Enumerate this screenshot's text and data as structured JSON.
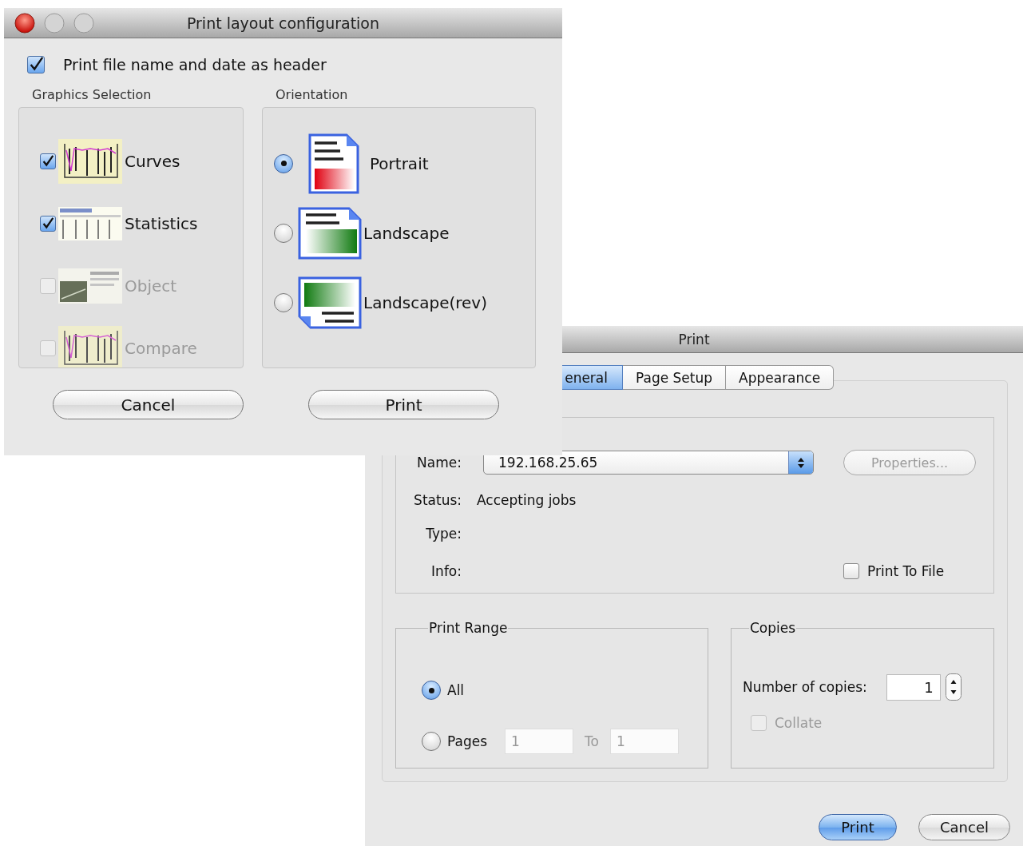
{
  "layout_dialog": {
    "title": "Print layout configuration",
    "header_option": {
      "label": "Print file name and date as header",
      "checked": true
    },
    "graphics_selection": {
      "label": "Graphics Selection",
      "items": [
        {
          "label": "Curves",
          "kind": "chart",
          "checked": true,
          "disabled": false
        },
        {
          "label": "Statistics",
          "kind": "table",
          "checked": true,
          "disabled": false
        },
        {
          "label": "Object",
          "kind": "mixed",
          "checked": false,
          "disabled": true
        },
        {
          "label": "Compare",
          "kind": "chart",
          "checked": false,
          "disabled": true
        }
      ]
    },
    "orientation": {
      "label": "Orientation",
      "options": [
        {
          "label": "Portrait",
          "kind": "portrait",
          "selected": true
        },
        {
          "label": "Landscape",
          "kind": "landscape",
          "selected": false
        },
        {
          "label": "Landscape(rev)",
          "kind": "landscape_rev",
          "selected": false
        }
      ]
    },
    "buttons": [
      {
        "label": "Cancel"
      },
      {
        "label": "Print"
      }
    ]
  },
  "print_dialog": {
    "title": "Print",
    "tabs": [
      {
        "label": "eneral",
        "selected": true
      },
      {
        "label": "Page Setup",
        "selected": false
      },
      {
        "label": "Appearance",
        "selected": false
      }
    ],
    "printer": {
      "name_label": "Name:",
      "name_value": "192.168.25.65",
      "properties_button": {
        "label": "Properties...",
        "disabled": true
      },
      "status_label": "Status:",
      "status_value": "Accepting jobs",
      "type_label": "Type:",
      "info_label": "Info:",
      "print_to_file": {
        "label": "Print To File",
        "checked": false
      }
    },
    "print_range": {
      "title": "Print Range",
      "options": [
        {
          "label": "All",
          "selected": true
        },
        {
          "label": "Pages",
          "selected": false
        }
      ],
      "from": "1",
      "to_label": "To",
      "to": "1"
    },
    "copies": {
      "title": "Copies",
      "label": "Number of copies:",
      "value": "1",
      "collate": {
        "label": "Collate",
        "checked": false,
        "disabled": true
      }
    },
    "buttons": [
      {
        "label": "Print",
        "default": true
      },
      {
        "label": "Cancel",
        "default": false
      }
    ]
  }
}
